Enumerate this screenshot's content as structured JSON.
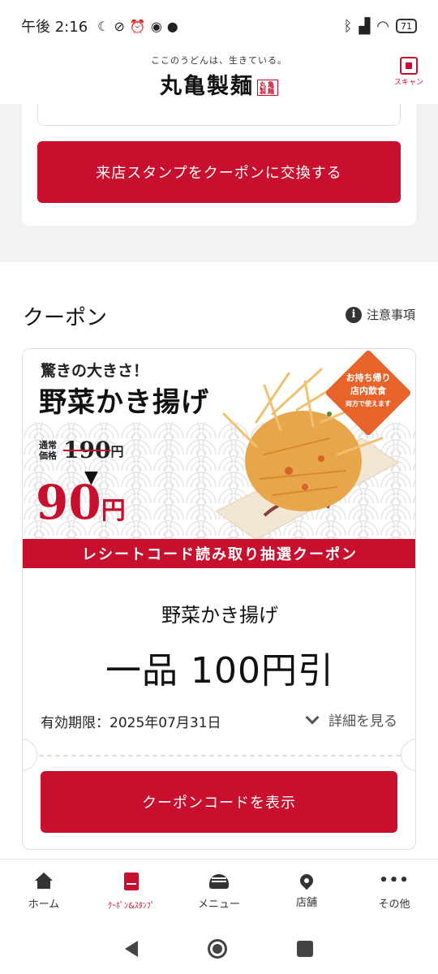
{
  "status_bar": {
    "time": "午後 2:16",
    "battery": "71"
  },
  "header": {
    "tagline": "ここのうどんは、生きている。",
    "logo": "丸亀製麺",
    "logo_seal": "丸亀製麺",
    "scan_label": "スキャン"
  },
  "stamp": {
    "exchange_button": "来店スタンプをクーポンに交換する"
  },
  "coupon_section": {
    "title": "クーポン",
    "notes_link": "注意事項"
  },
  "coupon": {
    "banner": {
      "catch": "驚きの大きさ！",
      "name": "野菜かき揚げ",
      "regular_label": "通常価格",
      "regular_price": "190",
      "regular_yen": "円",
      "sale_price": "90",
      "sale_yen": "円",
      "badge_line1": "お持ち帰り",
      "badge_line2": "店内飲食",
      "badge_line3": "両方で使えます",
      "ribbon": "レシートコード読み取り抽選クーポン"
    },
    "item": "野菜かき揚げ",
    "discount": "一品 100円引",
    "expiry": "有効期限：2025年07月31日",
    "detail_link": "詳細を見る",
    "code_button": "クーポンコードを表示"
  },
  "bottom_nav": {
    "home": "ホーム",
    "coupon": "ｸｰﾎﾟﾝ&ｽﾀﾝﾌﾟ",
    "menu": "メニュー",
    "stores": "店舗",
    "more": "その他"
  },
  "colors": {
    "brand_red": "#c8102e",
    "badge_orange": "#e8632a"
  }
}
